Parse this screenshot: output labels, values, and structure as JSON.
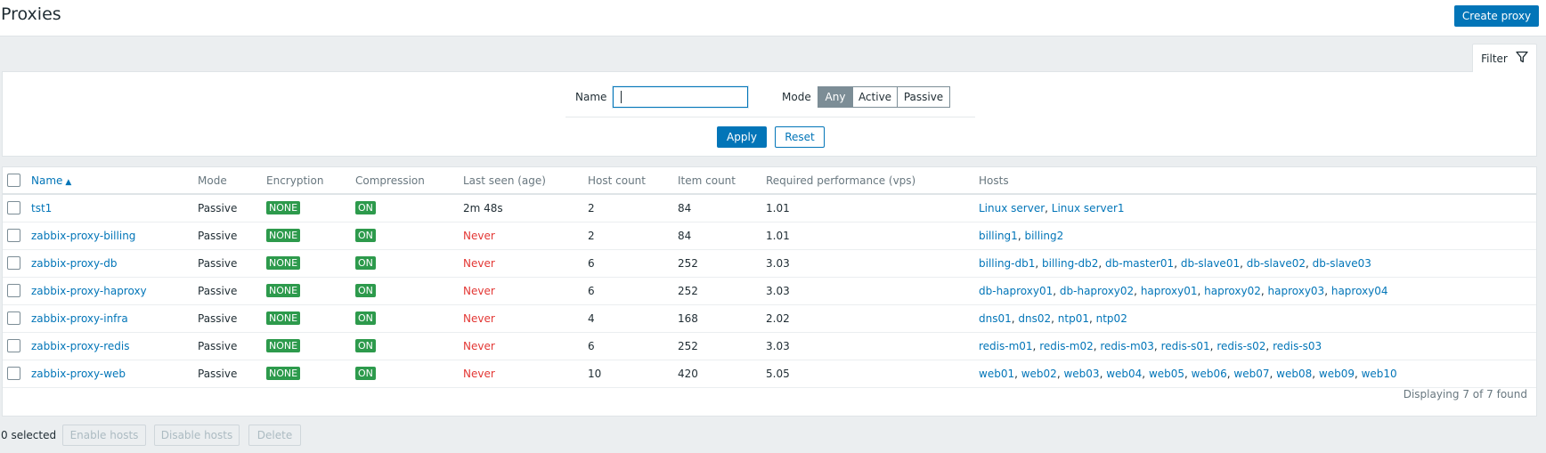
{
  "header": {
    "title": "Proxies",
    "create_label": "Create proxy"
  },
  "filter": {
    "tab_label": "Filter",
    "name_label": "Name",
    "name_value": "",
    "mode_label": "Mode",
    "mode_options": [
      "Any",
      "Active",
      "Passive"
    ],
    "mode_selected": "Any",
    "apply_label": "Apply",
    "reset_label": "Reset"
  },
  "table": {
    "columns": [
      "Name",
      "Mode",
      "Encryption",
      "Compression",
      "Last seen (age)",
      "Host count",
      "Item count",
      "Required performance (vps)",
      "Hosts"
    ],
    "sort_column": "Name",
    "sort_direction": "asc",
    "rows": [
      {
        "name": "tst1",
        "mode": "Passive",
        "encryption": "NONE",
        "compression": "ON",
        "last_seen": "2m 48s",
        "last_seen_never": false,
        "host_count": "2",
        "item_count": "84",
        "vps": "1.01",
        "hosts": [
          "Linux server",
          "Linux server1"
        ]
      },
      {
        "name": "zabbix-proxy-billing",
        "mode": "Passive",
        "encryption": "NONE",
        "compression": "ON",
        "last_seen": "Never",
        "last_seen_never": true,
        "host_count": "2",
        "item_count": "84",
        "vps": "1.01",
        "hosts": [
          "billing1",
          "billing2"
        ]
      },
      {
        "name": "zabbix-proxy-db",
        "mode": "Passive",
        "encryption": "NONE",
        "compression": "ON",
        "last_seen": "Never",
        "last_seen_never": true,
        "host_count": "6",
        "item_count": "252",
        "vps": "3.03",
        "hosts": [
          "billing-db1",
          "billing-db2",
          "db-master01",
          "db-slave01",
          "db-slave02",
          "db-slave03"
        ]
      },
      {
        "name": "zabbix-proxy-haproxy",
        "mode": "Passive",
        "encryption": "NONE",
        "compression": "ON",
        "last_seen": "Never",
        "last_seen_never": true,
        "host_count": "6",
        "item_count": "252",
        "vps": "3.03",
        "hosts": [
          "db-haproxy01",
          "db-haproxy02",
          "haproxy01",
          "haproxy02",
          "haproxy03",
          "haproxy04"
        ]
      },
      {
        "name": "zabbix-proxy-infra",
        "mode": "Passive",
        "encryption": "NONE",
        "compression": "ON",
        "last_seen": "Never",
        "last_seen_never": true,
        "host_count": "4",
        "item_count": "168",
        "vps": "2.02",
        "hosts": [
          "dns01",
          "dns02",
          "ntp01",
          "ntp02"
        ]
      },
      {
        "name": "zabbix-proxy-redis",
        "mode": "Passive",
        "encryption": "NONE",
        "compression": "ON",
        "last_seen": "Never",
        "last_seen_never": true,
        "host_count": "6",
        "item_count": "252",
        "vps": "3.03",
        "hosts": [
          "redis-m01",
          "redis-m02",
          "redis-m03",
          "redis-s01",
          "redis-s02",
          "redis-s03"
        ]
      },
      {
        "name": "zabbix-proxy-web",
        "mode": "Passive",
        "encryption": "NONE",
        "compression": "ON",
        "last_seen": "Never",
        "last_seen_never": true,
        "host_count": "10",
        "item_count": "420",
        "vps": "5.05",
        "hosts": [
          "web01",
          "web02",
          "web03",
          "web04",
          "web05",
          "web06",
          "web07",
          "web08",
          "web09",
          "web10"
        ]
      }
    ],
    "footer": "Displaying 7 of 7 found"
  },
  "actions": {
    "selected": "0 selected",
    "enable_label": "Enable hosts",
    "disable_label": "Disable hosts",
    "delete_label": "Delete"
  },
  "colors": {
    "primary": "#0275b8",
    "badge_green": "#2d9a4c",
    "never_red": "#e33734",
    "background": "#ebeef0"
  },
  "icons": {
    "filter": "funnel-icon",
    "sort": "sort-up-arrow-icon"
  }
}
